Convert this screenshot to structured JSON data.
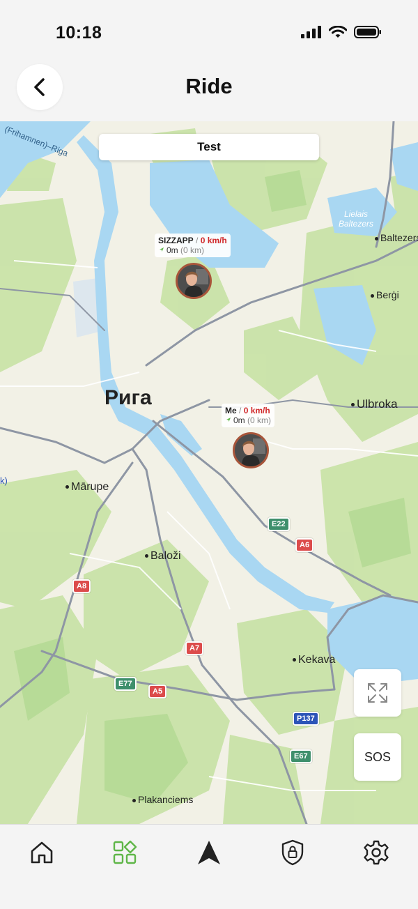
{
  "status_bar": {
    "time": "10:18"
  },
  "header": {
    "title": "Ride",
    "back_icon": "chevron-left-icon"
  },
  "map": {
    "group_name": "Test",
    "riders": [
      {
        "name": "SIZZAPP",
        "speed": "0 km/h",
        "distance": "0m",
        "total": "(0 km)"
      },
      {
        "name": "Me",
        "speed": "0 km/h",
        "distance": "0m",
        "total": "(0 km)"
      }
    ],
    "places": {
      "riga": "Рига",
      "marupe": "Mārupe",
      "balozi": "Baloži",
      "ulbroka": "Ulbroka",
      "kekava": "Kekava",
      "plakanciems": "Plakanciems",
      "bergi": "Berģi",
      "baltezers": "Baltezers",
      "lielais_line1": "Lielais",
      "lielais_line2": "Baltezers",
      "frihamnen": "(Frihamnen)–Riga",
      "left_edge": "k)"
    },
    "roads": {
      "e22": "E22",
      "a6": "A6",
      "a8": "A8",
      "a7": "A7",
      "e77": "E77",
      "a5": "A5",
      "p137": "P137",
      "e67": "E67"
    },
    "buttons": {
      "fullscreen_icon": "expand-icon",
      "sos": "SOS"
    }
  },
  "tab_bar": {
    "items": [
      "home-icon",
      "apps-icon",
      "navigation-arrow-icon",
      "shield-lock-icon",
      "gear-icon"
    ],
    "active": "apps-icon",
    "active_color": "#5fb648"
  },
  "colors": {
    "water": "#a9d7f2",
    "forest": "#c9e3a8",
    "rider_speed": "#d0282a",
    "road_red": "#dc4b4b",
    "road_green": "#3e8f6c",
    "road_blue": "#2c54b8"
  }
}
